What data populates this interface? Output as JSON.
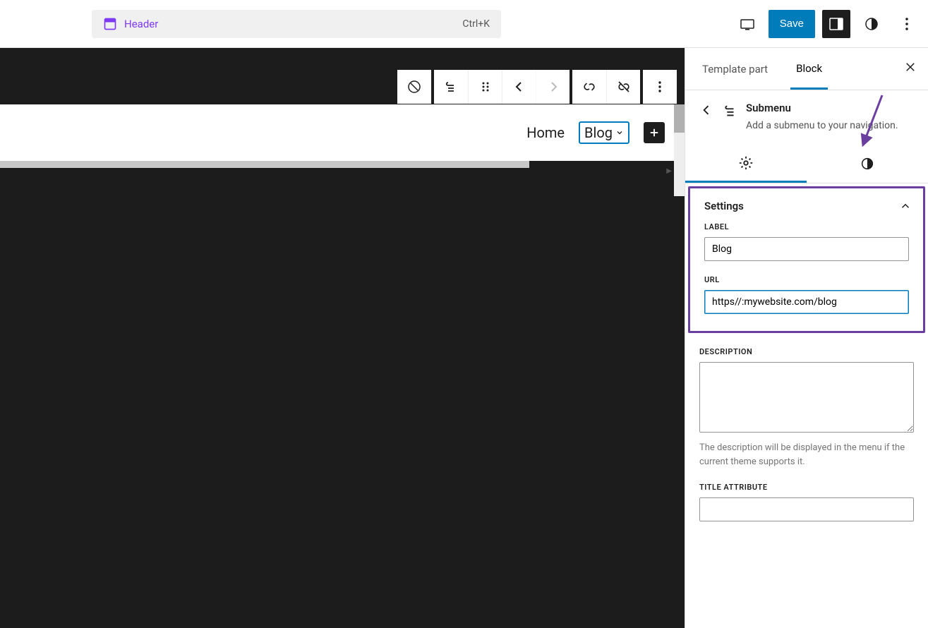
{
  "topbar": {
    "doc_title": "Header",
    "shortcut": "Ctrl+K",
    "save_label": "Save"
  },
  "canvas": {
    "nav": {
      "home": "Home",
      "blog": "Blog"
    }
  },
  "sidebar": {
    "tabs": {
      "template_part": "Template part",
      "block": "Block"
    },
    "block": {
      "title": "Submenu",
      "desc": "Add a submenu to your navigation."
    },
    "settings_panel": {
      "title": "Settings",
      "label_label": "LABEL",
      "label_value": "Blog",
      "url_label": "URL",
      "url_value": "https//:mywebsite.com/blog",
      "desc_label": "DESCRIPTION",
      "desc_value": "",
      "desc_help": "The description will be displayed in the menu if the current theme supports it.",
      "title_attr_label": "TITLE ATTRIBUTE",
      "title_attr_value": ""
    }
  }
}
